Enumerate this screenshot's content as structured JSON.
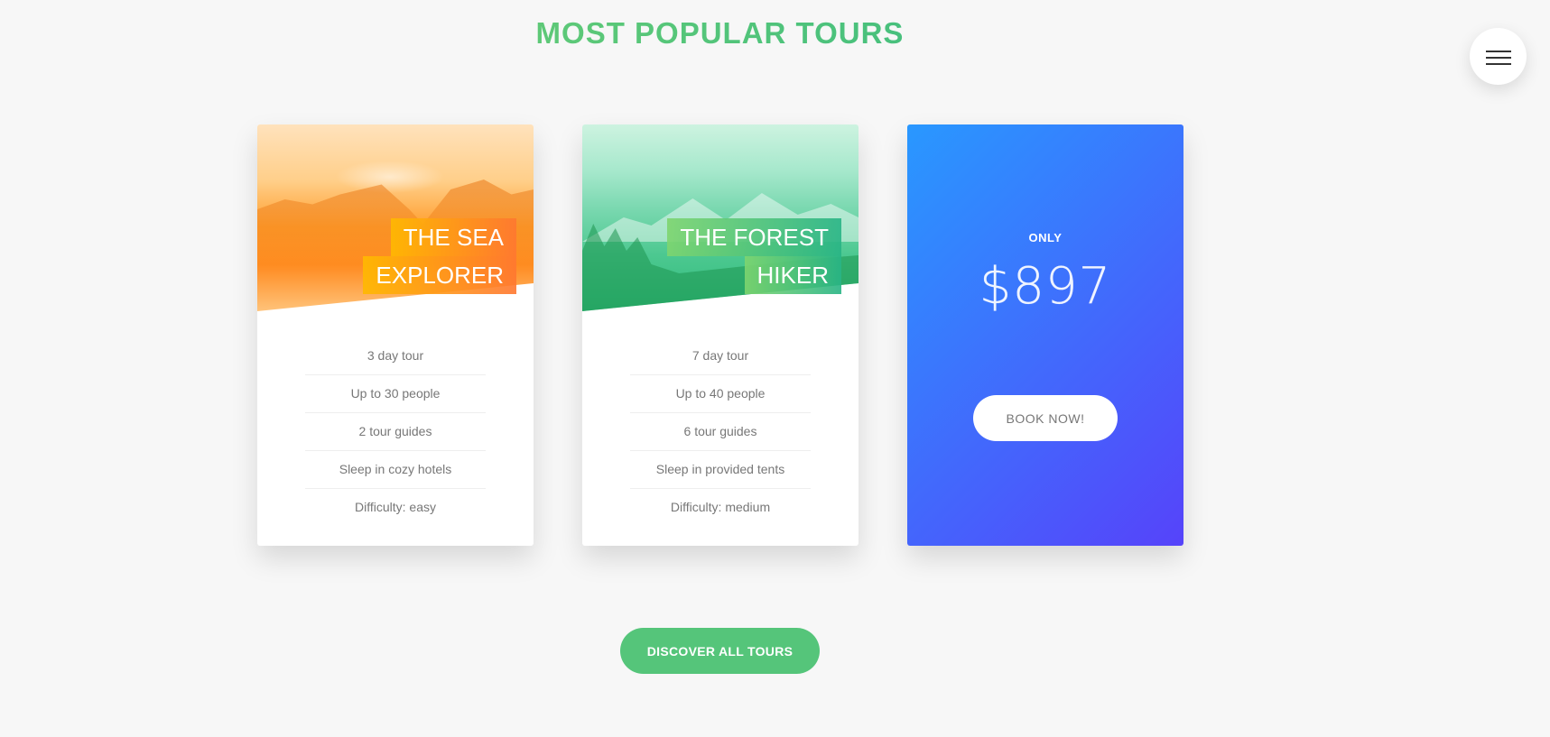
{
  "section": {
    "title": "MOST POPULAR TOURS"
  },
  "navigation": {
    "icon": "hamburger-menu-icon"
  },
  "tours": [
    {
      "heading_line1": "THE SEA",
      "heading_line2": "EXPLORER",
      "details": [
        "3 day tour",
        "Up to 30 people",
        "2 tour guides",
        "Sleep in cozy hotels",
        "Difficulty: easy"
      ]
    },
    {
      "heading_line1": "THE FOREST",
      "heading_line2": "HIKER",
      "details": [
        "7 day tour",
        "Up to 40 people",
        "6 tour guides",
        "Sleep in provided tents",
        "Difficulty: medium"
      ]
    }
  ],
  "price_card": {
    "only_label": "ONLY",
    "price": "$897",
    "book_label": "BOOK NOW!"
  },
  "discover": {
    "label": "DISCOVER ALL TOURS"
  },
  "colors": {
    "green_light": "#7ed56f",
    "green_dark": "#28b485",
    "orange_light": "#ffb900",
    "orange_dark": "#ff7730",
    "blue_light": "#2998ff",
    "blue_dark": "#5643fa",
    "button_green": "#55c57a",
    "background": "#f7f7f7"
  }
}
